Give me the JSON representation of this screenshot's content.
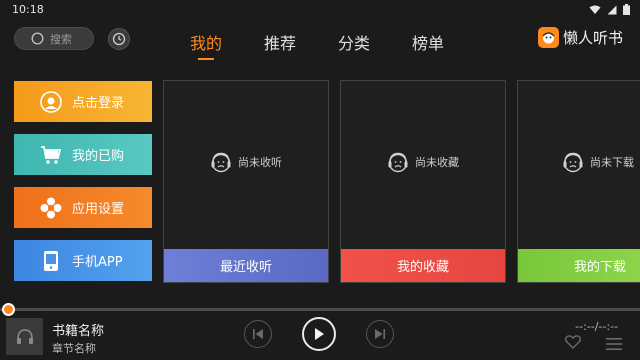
{
  "status_bar": {
    "time": "10:18"
  },
  "header": {
    "search_placeholder": "搜索",
    "tabs": [
      {
        "label": "我的",
        "active": true
      },
      {
        "label": "推荐",
        "active": false
      },
      {
        "label": "分类",
        "active": false
      },
      {
        "label": "榜单",
        "active": false
      }
    ],
    "brand_name": "懒人听书",
    "accent_color": "#ff8a1c"
  },
  "side_menu": [
    {
      "label": "点击登录",
      "icon": "headset-avatar-icon",
      "color": "#f7a823"
    },
    {
      "label": "我的已购",
      "icon": "cart-icon",
      "color": "#4dbdb8"
    },
    {
      "label": "应用设置",
      "icon": "flower-gear-icon",
      "color": "#f27a22"
    },
    {
      "label": "手机APP",
      "icon": "phone-app-icon",
      "color": "#4892e8"
    }
  ],
  "cards": [
    {
      "empty_text": "尚未收听",
      "footer": "最近收听",
      "color": "#6576cf",
      "icon": "sad-headphones-icon"
    },
    {
      "empty_text": "尚未收藏",
      "footer": "我的收藏",
      "color": "#eb4c45",
      "icon": "sad-headphones-icon"
    },
    {
      "empty_text": "尚未下载",
      "footer": "我的下载",
      "color": "#84cd42",
      "icon": "sad-headphones-icon"
    }
  ],
  "player": {
    "book_name": "书籍名称",
    "chapter_name": "章节名称",
    "time": "--:--/--:--",
    "progress": 0.0
  }
}
